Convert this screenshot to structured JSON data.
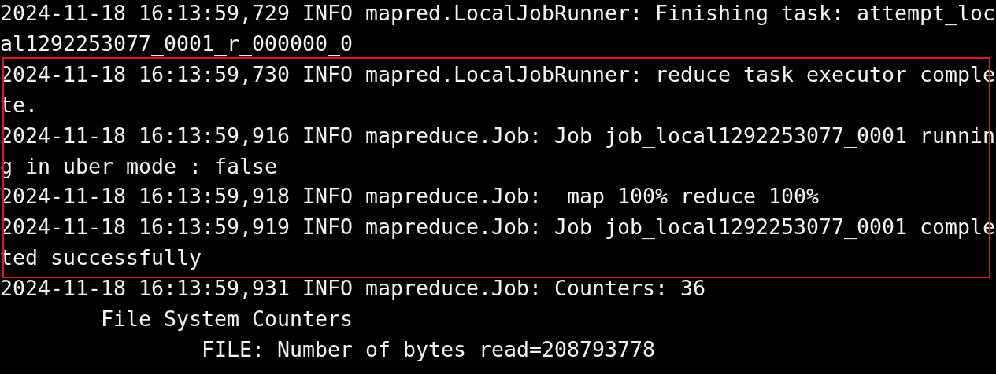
{
  "terminal": {
    "lines": [
      {
        "text": "2024-11-18 16:13:59,729 INFO mapred.LocalJobRunner: Finishing task: attempt_local1292253077_0001_r_000000_0",
        "highlighted": false
      },
      {
        "text": "2024-11-18 16:13:59,730 INFO mapred.LocalJobRunner: reduce task executor complete.",
        "highlighted": true
      },
      {
        "text": "2024-11-18 16:13:59,916 INFO mapreduce.Job: Job job_local1292253077_0001 running in uber mode : false",
        "highlighted": true
      },
      {
        "text": "2024-11-18 16:13:59,918 INFO mapreduce.Job:  map 100% reduce 100%",
        "highlighted": true
      },
      {
        "text": "2024-11-18 16:13:59,919 INFO mapreduce.Job: Job job_local1292253077_0001 completed successfully",
        "highlighted": true
      },
      {
        "text": "2024-11-18 16:13:59,931 INFO mapreduce.Job: Counters: 36",
        "highlighted": false
      },
      {
        "text": "        File System Counters",
        "highlighted": false
      },
      {
        "text": "                FILE: Number of bytes read=208793778",
        "highlighted": false
      }
    ]
  }
}
